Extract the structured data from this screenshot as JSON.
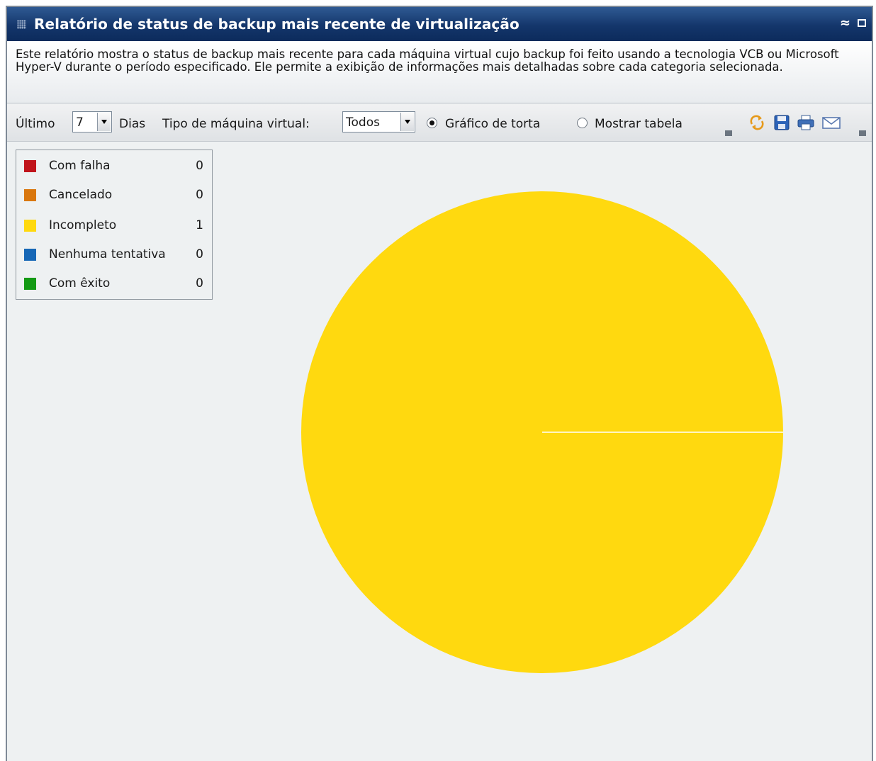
{
  "panel": {
    "title": "Relatório de status de backup mais recente de virtualização",
    "description": "Este relatório mostra o status de backup mais recente para cada máquina virtual cujo backup foi feito usando a tecnologia VCB ou Microsoft Hyper-V durante o período especificado. Ele permite a exibição de informações mais detalhadas sobre cada categoria selecionada."
  },
  "toolbar": {
    "last_label": "Último",
    "days_value": "7",
    "days_label": "Dias",
    "vm_type_label": "Tipo de máquina virtual:",
    "vm_type_value": "Todos",
    "pie_label": "Gráfico de torta",
    "table_label": "Mostrar tabela",
    "selected_view": "pie"
  },
  "icons": [
    "double-chevron-up-icon",
    "maximize-icon",
    "refresh-icon",
    "save-icon",
    "print-icon",
    "email-icon"
  ],
  "chart_data": {
    "type": "pie",
    "legend_position": "top-left",
    "categories": [
      "Com falha",
      "Cancelado",
      "Incompleto",
      "Nenhuma tentativa",
      "Com êxito"
    ],
    "values": [
      0,
      0,
      1,
      0,
      0
    ],
    "colors": [
      "#c0141b",
      "#d9770e",
      "#ffd90f",
      "#1667b6",
      "#149a14"
    ]
  },
  "legend": {
    "items": [
      {
        "label": "Com falha",
        "count": "0",
        "color": "#c0141b"
      },
      {
        "label": "Cancelado",
        "count": "0",
        "color": "#d9770e"
      },
      {
        "label": "Incompleto",
        "count": "1",
        "color": "#ffd90f"
      },
      {
        "label": "Nenhuma tentativa",
        "count": "0",
        "color": "#1667b6"
      },
      {
        "label": "Com êxito",
        "count": "0",
        "color": "#149a14"
      }
    ]
  }
}
